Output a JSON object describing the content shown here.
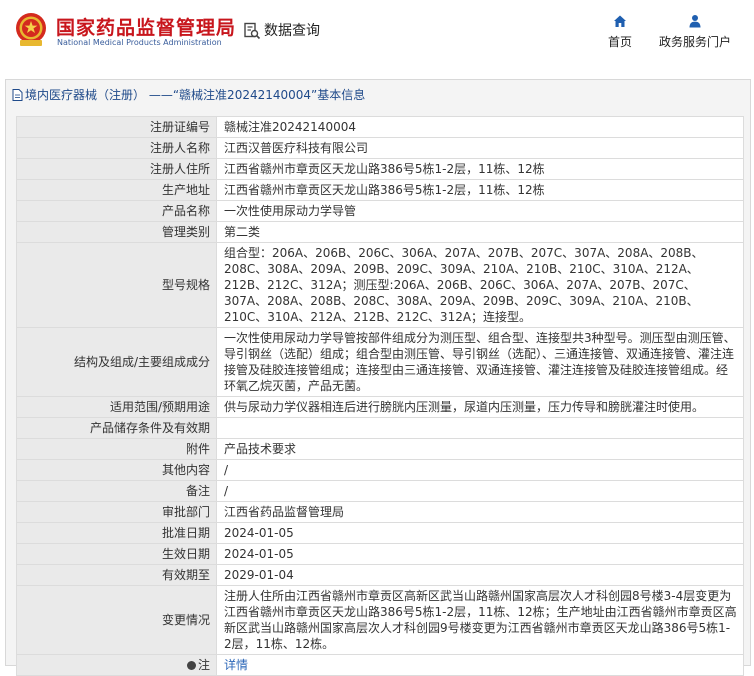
{
  "header": {
    "brand_cn": "国家药品监督管理局",
    "brand_en": "National Medical Products Administration",
    "data_query": "数据查询",
    "nav_home": "首页",
    "nav_portal": "政务服务门户",
    "accent_red": "#c8161d",
    "accent_blue": "#1f4a8a",
    "nav_icon_color": "#1f5fb0"
  },
  "breadcrumb": {
    "category": "境内医疗器械（注册）",
    "separator": "——",
    "title": "“赣械注准20242140004”基本信息"
  },
  "rows": [
    {
      "label": "注册证编号",
      "value": "赣械注准20242140004"
    },
    {
      "label": "注册人名称",
      "value": "江西汉普医疗科技有限公司"
    },
    {
      "label": "注册人住所",
      "value": "江西省赣州市章贡区天龙山路386号5栋1-2层，11栋、12栋"
    },
    {
      "label": "生产地址",
      "value": "江西省赣州市章贡区天龙山路386号5栋1-2层，11栋、12栋"
    },
    {
      "label": "产品名称",
      "value": "一次性使用尿动力学导管"
    },
    {
      "label": "管理类别",
      "value": "第二类"
    },
    {
      "label": "型号规格",
      "value": "组合型：206A、206B、206C、306A、207A、207B、207C、307A、208A、208B、208C、308A、209A、209B、209C、309A、210A、210B、210C、310A、212A、212B、212C、312A；测压型:206A、206B、206C、306A、207A、207B、207C、307A、208A、208B、208C、308A、209A、209B、209C、309A、210A、210B、210C、310A、212A、212B、212C、312A；连接型。"
    },
    {
      "label": "结构及组成/主要组成成分",
      "value": "一次性使用尿动力学导管按部件组成分为测压型、组合型、连接型共3种型号。测压型由测压管、导引钢丝（选配）组成；组合型由测压管、导引钢丝（选配）、三通连接管、双通连接管、灌注连接管及硅胶连接管组成；连接型由三通连接管、双通连接管、灌注连接管及硅胶连接管组成。经环氧乙烷灭菌，产品无菌。"
    },
    {
      "label": "适用范围/预期用途",
      "value": "供与尿动力学仪器相连后进行膀胱内压测量，尿道内压测量，压力传导和膀胱灌注时使用。"
    },
    {
      "label": "产品储存条件及有效期",
      "value": ""
    },
    {
      "label": "附件",
      "value": "产品技术要求"
    },
    {
      "label": "其他内容",
      "value": "/"
    },
    {
      "label": "备注",
      "value": "/"
    },
    {
      "label": "审批部门",
      "value": "江西省药品监督管理局"
    },
    {
      "label": "批准日期",
      "value": "2024-01-05"
    },
    {
      "label": "生效日期",
      "value": "2024-01-05"
    },
    {
      "label": "有效期至",
      "value": "2029-01-04"
    },
    {
      "label": "变更情况",
      "value": "注册人住所由江西省赣州市章贡区高新区武当山路赣州国家高层次人才科创园8号楼3-4层变更为江西省赣州市章贡区天龙山路386号5栋1-2层，11栋、12栋；生产地址由江西省赣州市章贡区高新区武当山路赣州国家高层次人才科创园9号楼变更为江西省赣州市章贡区天龙山路386号5栋1-2层，11栋、12栋。"
    }
  ],
  "note": {
    "label": "注",
    "link": "详情"
  }
}
